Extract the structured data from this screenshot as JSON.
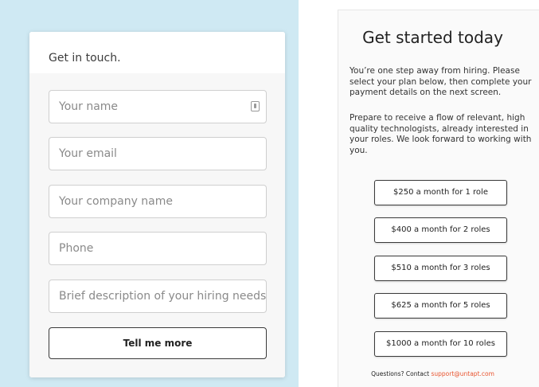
{
  "contact_form": {
    "title": "Get in touch.",
    "fields": {
      "name_placeholder": "Your name",
      "email_placeholder": "Your email",
      "company_placeholder": "Your company name",
      "phone_placeholder": "Phone",
      "description_placeholder": "Brief description of your hiring needs"
    },
    "submit_label": "Tell me more"
  },
  "pricing": {
    "title": "Get started today",
    "para1": "You’re one step away from hiring. Please select your plan below, then complete your payment details on the next screen.",
    "para2": "Prepare to receive a flow of relevant, high quality technologists, already interested in your roles. We look forward to working with you.",
    "plans": [
      "$250 a month for 1 role",
      "$400 a month for 2 roles",
      "$510 a month for 3 roles",
      "$625 a month for 5 roles",
      "$1000 a month for 10 roles"
    ],
    "footer_prefix": "Questions? Contact",
    "footer_email": "support@untapt.com"
  },
  "colors": {
    "left_background": "#cfe9f3",
    "link": "#e8542f"
  }
}
